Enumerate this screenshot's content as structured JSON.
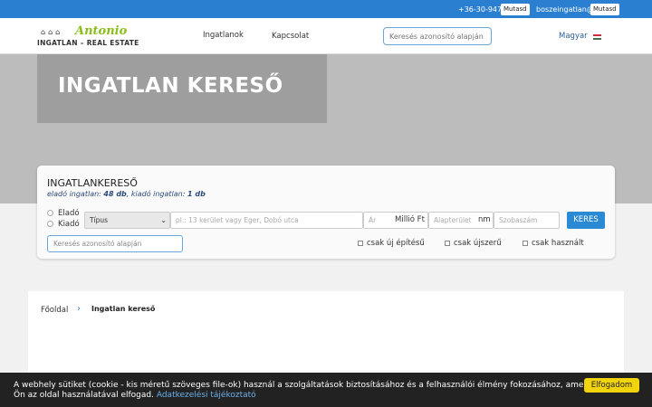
{
  "topbar": {
    "phone": "+36-30-947-",
    "email": "boszeingatlan@",
    "reveal_label": "Mutasd"
  },
  "navbar": {
    "logo_script": "Antonio",
    "logo_sub": "INGATLAN – REAL ESTATE",
    "links": [
      "Ingatlanok",
      "Kapcsolat"
    ],
    "search_placeholder": "Keresés azonosító alapján",
    "language": "Magyar",
    "flag_colors": [
      "#cd2a3e",
      "#ffffff",
      "#436f4d"
    ]
  },
  "hero": {
    "title": "INGATLAN KERESŐ"
  },
  "search_panel": {
    "title": "INGATLANKERESŐ",
    "counts_prefix_sale": "eladó ingatlan: ",
    "sale_count": "48 db",
    "counts_sep": ", kiadó ingatlan: ",
    "rent_count": "1 db",
    "radio_sale": "Eladó",
    "radio_rent": "Kiadó",
    "type_select": "Típus",
    "location_placeholder": "pl.: 13 kerület vagy Eger, Dobó utca",
    "price_placeholder": "Ár",
    "price_unit": "Millió Ft",
    "area_placeholder": "Alapterület",
    "area_unit": "nm",
    "rooms_placeholder": "Szobaszám",
    "search_button": "KERES",
    "id_search_placeholder": "Keresés azonosító alapján",
    "checkboxes": [
      "csak új építésű",
      "csak újszerű",
      "csak használt"
    ]
  },
  "breadcrumb": {
    "home": "Főoldal",
    "separator": "›",
    "current": "Ingatlan kereső"
  },
  "cookie": {
    "line1": "A webhely sütiket (cookie - kis méretű szöveges file-ok) használ a szolgáltatások biztosításához és a felhasználói élmény fokozásához, amelyet",
    "line2": "Ön az oldal használatával elfogad. ",
    "link": "Adatkezelési tájékoztató",
    "accept": "Elfogadom"
  }
}
